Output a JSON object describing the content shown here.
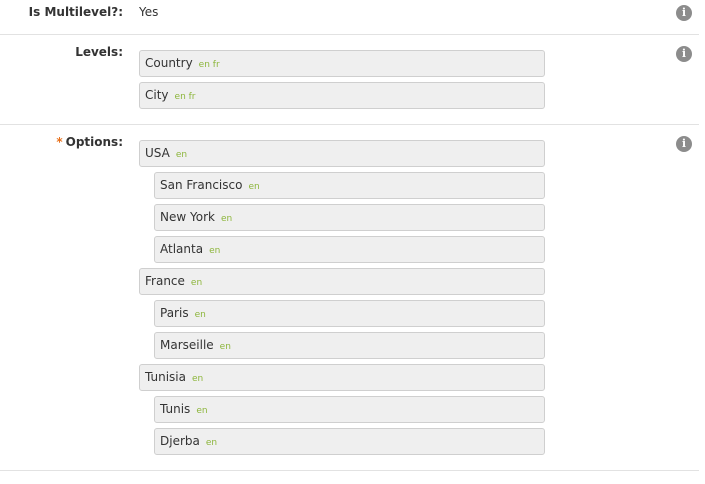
{
  "multilevel": {
    "label": "Is Multilevel?:",
    "value": "Yes"
  },
  "levels": {
    "label": "Levels:",
    "items": [
      {
        "name": "Country",
        "langs": "en fr"
      },
      {
        "name": "City",
        "langs": "en fr"
      }
    ]
  },
  "options": {
    "required_mark": "*",
    "label": "Options:",
    "items": [
      {
        "name": "USA",
        "langs": "en",
        "depth": 0
      },
      {
        "name": "San Francisco",
        "langs": "en",
        "depth": 1
      },
      {
        "name": "New York",
        "langs": "en",
        "depth": 1
      },
      {
        "name": "Atlanta",
        "langs": "en",
        "depth": 1
      },
      {
        "name": "France",
        "langs": "en",
        "depth": 0
      },
      {
        "name": "Paris",
        "langs": "en",
        "depth": 1
      },
      {
        "name": "Marseille",
        "langs": "en",
        "depth": 1
      },
      {
        "name": "Tunisia",
        "langs": "en",
        "depth": 0
      },
      {
        "name": "Tunis",
        "langs": "en",
        "depth": 1
      },
      {
        "name": "Djerba",
        "langs": "en",
        "depth": 1
      }
    ]
  },
  "icons": {
    "info": "info-icon",
    "info_glyph": "i"
  },
  "colors": {
    "required": "#e8711c",
    "language_tag": "#8db63c",
    "info_icon": "#8c8c8c"
  }
}
